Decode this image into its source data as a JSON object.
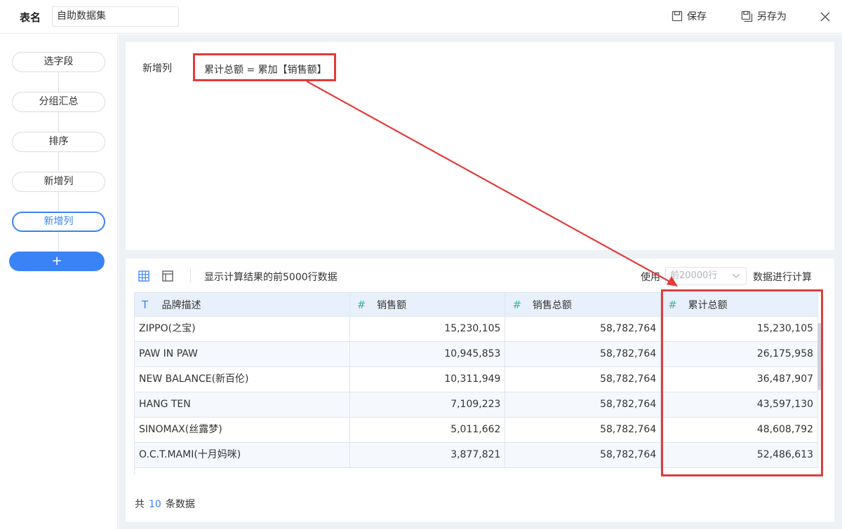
{
  "header": {
    "name_label": "表名",
    "name_value": "自助数据集",
    "save_label": "保存",
    "save_as_label": "另存为"
  },
  "steps": [
    {
      "label": "选字段",
      "active": false
    },
    {
      "label": "分组汇总",
      "active": false
    },
    {
      "label": "排序",
      "active": false
    },
    {
      "label": "新增列",
      "active": false
    },
    {
      "label": "新增列",
      "active": true
    }
  ],
  "add_step_label": "+",
  "formula": {
    "label": "新增列",
    "text": "累计总额 = 累加【销售额】"
  },
  "toolbar": {
    "preview_text": "显示计算结果的前5000行数据",
    "use_text": "使用",
    "rows_select_value": "前20000行",
    "calc_text": "数据进行计算"
  },
  "table": {
    "columns": [
      {
        "type_icon": "T",
        "label": "品牌描述"
      },
      {
        "type_icon": "#",
        "label": "销售额"
      },
      {
        "type_icon": "#",
        "label": "销售总额"
      },
      {
        "type_icon": "#",
        "label": "累计总额"
      }
    ],
    "rows": [
      [
        "ZIPPO(之宝)",
        "15,230,105",
        "58,782,764",
        "15,230,105"
      ],
      [
        "PAW IN PAW",
        "10,945,853",
        "58,782,764",
        "26,175,958"
      ],
      [
        "NEW BALANCE(新百伦)",
        "10,311,949",
        "58,782,764",
        "36,487,907"
      ],
      [
        "HANG TEN",
        "7,109,223",
        "58,782,764",
        "43,597,130"
      ],
      [
        "SINOMAX(丝露梦)",
        "5,011,662",
        "58,782,764",
        "48,608,792"
      ],
      [
        "O.C.T.MAMI(十月妈咪)",
        "3,877,821",
        "58,782,764",
        "52,486,613"
      ]
    ]
  },
  "footer": {
    "prefix": "共",
    "count": "10",
    "suffix": "条数据"
  },
  "colors": {
    "accent": "#3a83f7",
    "annotation_red": "#e23b3b",
    "number_icon": "#3cb5a2"
  }
}
